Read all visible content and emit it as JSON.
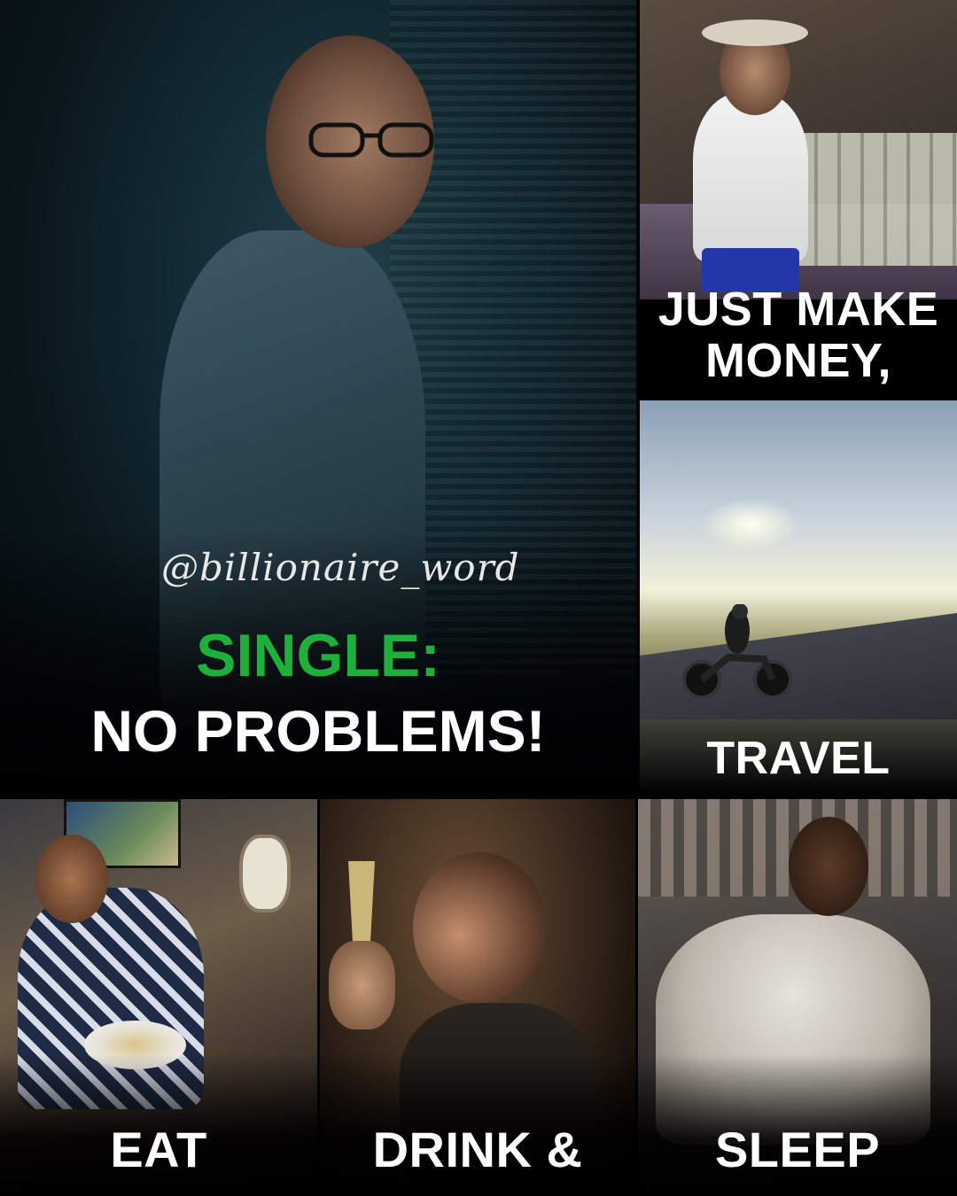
{
  "main": {
    "handle": "@billionaire_word",
    "headline_line1": "SINGLE:",
    "headline_line2": "NO PROBLEMS!",
    "accent_color": "#1fb03c"
  },
  "panels": {
    "money": {
      "caption": "JUST MAKE MONEY,"
    },
    "travel": {
      "caption": "TRAVEL"
    },
    "eat": {
      "caption": "EAT"
    },
    "drink": {
      "caption": "DRINK &"
    },
    "sleep": {
      "caption": "SLEEP"
    }
  }
}
